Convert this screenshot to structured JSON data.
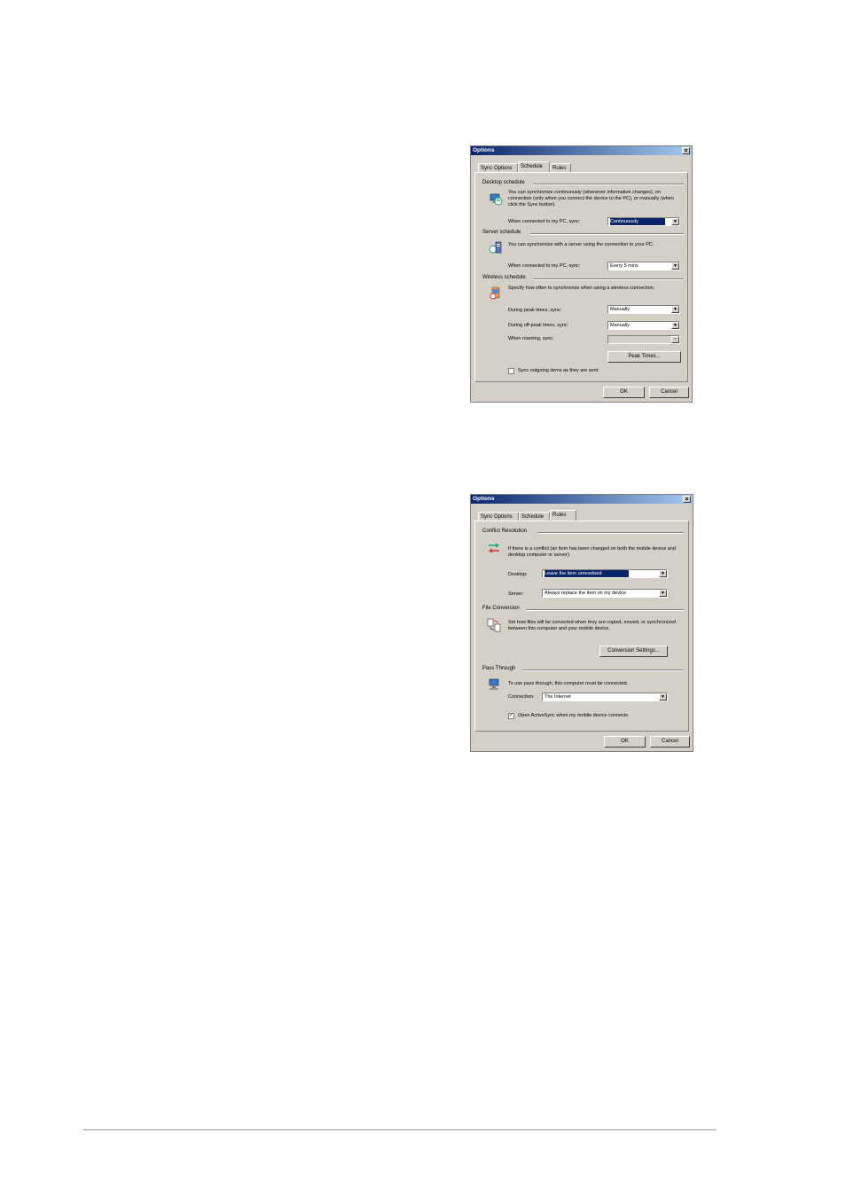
{
  "dialog1": {
    "title": "Options",
    "close": "×",
    "tabs": [
      "Sync Options",
      "Schedule",
      "Rules"
    ],
    "desktop_group": "Desktop schedule",
    "desktop_text": "You can synchronize continuously (whenever information changes), on connection (only when you connect the device to the PC), or manually (when click the Sync button).",
    "desktop_label": "When connected to my PC, sync:",
    "desktop_value": "Continuously",
    "server_group": "Server schedule",
    "server_text": "You can synchronize with a server using the connection to your PC.",
    "server_label": "When connected to my PC, sync:",
    "server_value": "Every 5 mins",
    "wireless_group": "Wireless schedule",
    "wireless_text": "Specify how often to synchronize when using a wireless connection.",
    "peak_label": "During peak times, sync:",
    "peak_value": "Manually",
    "offpeak_label": "During off-peak times, sync:",
    "offpeak_value": "Manually",
    "roaming_label": "When roaming, sync:",
    "peak_times_button": "Peak Times...",
    "sync_outgoing_label": "Sync outgoing items as they are sent.",
    "ok": "OK",
    "cancel": "Cancel",
    "arrow": "▼"
  },
  "dialog2": {
    "title": "Options",
    "close": "×",
    "tabs": [
      "Sync Options",
      "Schedule",
      "Rules"
    ],
    "conflict_group": "Conflict Resolution",
    "conflict_text": "If there is a conflict (an item has been changed on both the mobile device and desktop computer or server):",
    "desktop_label": "Desktop:",
    "desktop_value": "Leave the item unresolved",
    "server_label": "Server:",
    "server_value": "Always replace the item on my device",
    "file_group": "File Conversion",
    "file_text": "Set how files will be converted when they are copied, moved, or synchronized between this computer and your mobile device.",
    "conversion_button": "Conversion Settings...",
    "pass_group": "Pass Through",
    "pass_text": "To use pass through, this computer must be connected.",
    "connection_label": "Connection:",
    "connection_value": "The Internet",
    "open_label": "Open ActiveSync when my mobile device connects",
    "check": "✓",
    "ok": "OK",
    "cancel": "Cancel",
    "arrow": "▼"
  }
}
